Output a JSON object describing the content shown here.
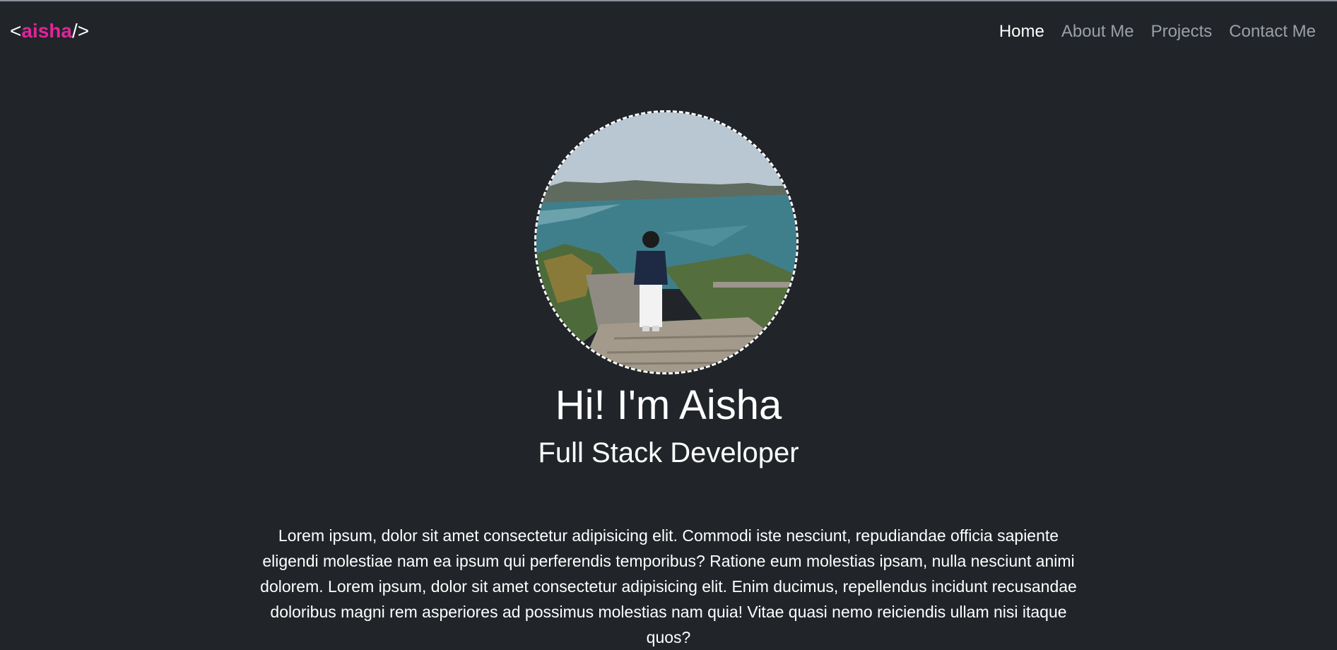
{
  "nav": {
    "brand_open": "<",
    "brand_name": "aisha",
    "brand_close": "/>",
    "links": [
      {
        "label": "Home",
        "active": true
      },
      {
        "label": "About Me",
        "active": false
      },
      {
        "label": "Projects",
        "active": false
      },
      {
        "label": "Contact Me",
        "active": false
      }
    ]
  },
  "hero": {
    "title": "Hi! I'm Aisha",
    "subtitle": "Full Stack Developer",
    "bio": "Lorem ipsum, dolor sit amet consectetur adipisicing elit. Commodi iste nesciunt, repudiandae officia sapiente eligendi molestiae nam ea ipsum qui perferendis temporibus? Ratione eum molestias ipsam, nulla nesciunt animi dolorem. Lorem ipsum, dolor sit amet consectetur adipisicing elit. Enim ducimus, repellendus incidunt recusandae doloribus magni rem asperiores ad possimus molestias nam quia! Vitae quasi nemo reiciendis ullam nisi itaque quos?"
  },
  "colors": {
    "background": "#212529",
    "brand_accent": "#e0249b",
    "nav_inactive": "#9aa0a6",
    "text": "#ffffff"
  }
}
